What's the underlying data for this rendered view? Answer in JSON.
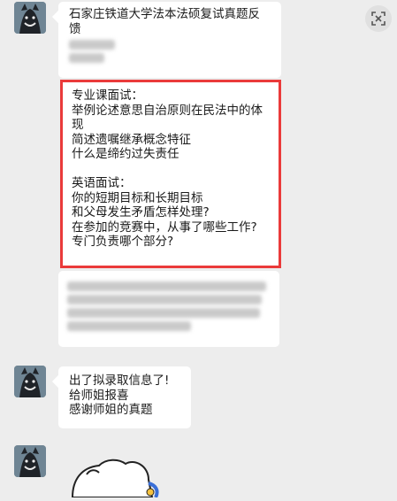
{
  "messages": [
    {
      "lines": [
        "石家庄铁道大学法本法硕复试真题反",
        "馈"
      ]
    },
    {
      "lines": [
        "专业课面试：",
        "举例论述意思自治原则在民法中的体",
        "现",
        "简述遗嘱继承概念特征",
        "什么是缔约过失责任",
        "",
        "英语面试：",
        "你的短期目标和长期目标",
        "和父母发生矛盾怎样处理?",
        "在参加的竞赛中，从事了哪些工作?",
        "专门负责哪个部分?"
      ]
    },
    {
      "lines": [
        "出了拟录取信息了!",
        "给师姐报喜",
        "感谢师姐的真题"
      ]
    }
  ],
  "icons": {
    "ocr": "scan-text-icon"
  },
  "colors": {
    "highlight_border": "#ea3a3a",
    "background": "#ededed",
    "bubble": "#ffffff"
  }
}
